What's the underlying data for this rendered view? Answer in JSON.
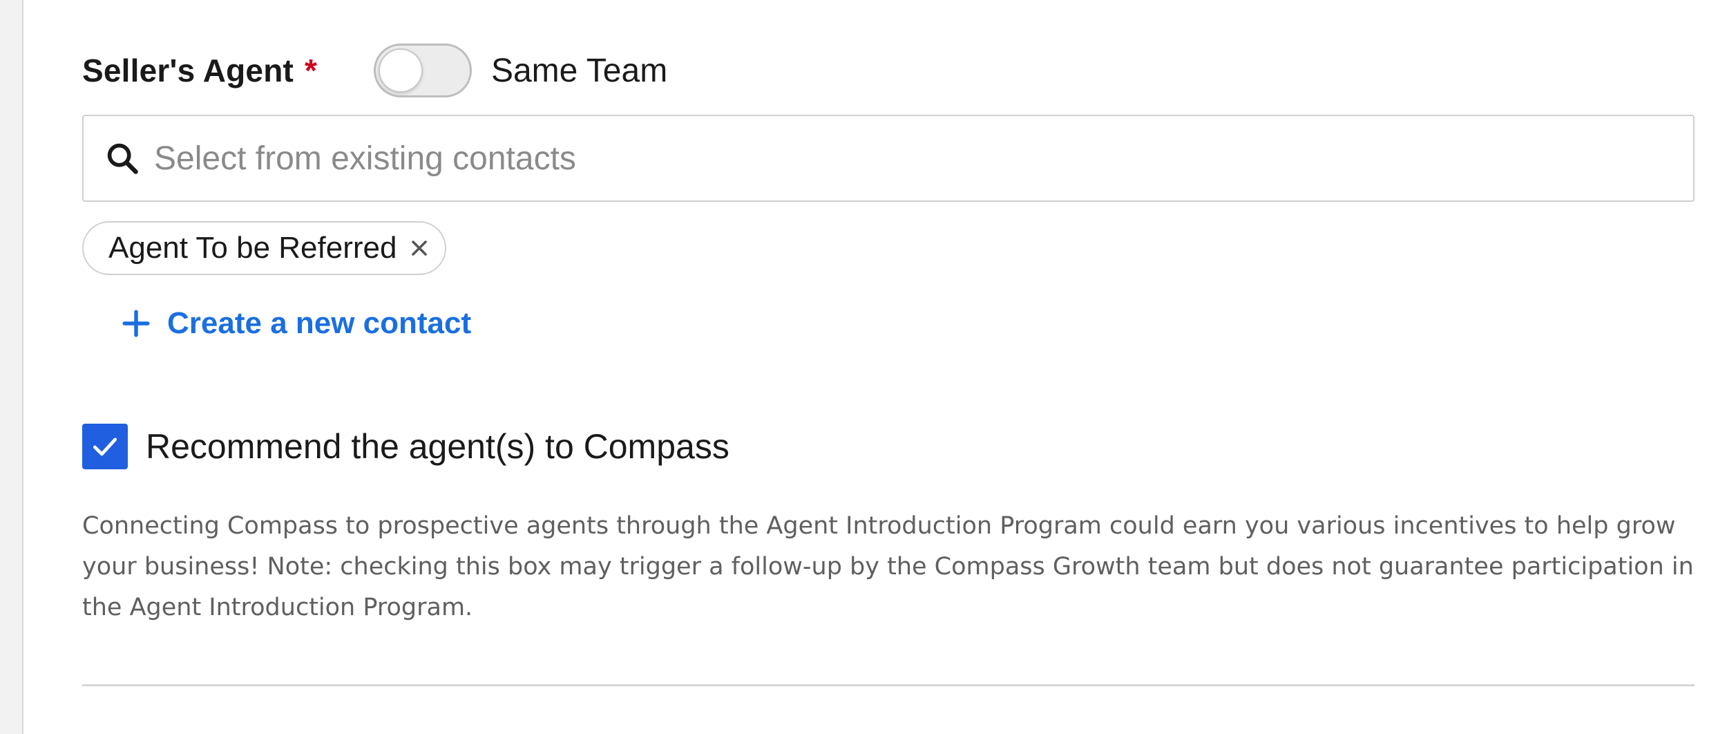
{
  "sellers_agent": {
    "label": "Seller's Agent",
    "required_marker": "*",
    "toggle_label": "Same Team",
    "toggle_on": false
  },
  "search": {
    "placeholder": "Select from existing contacts",
    "icon": "search-icon"
  },
  "selected_contacts": [
    {
      "label": "Agent To be Referred",
      "remove_icon": "close-icon"
    }
  ],
  "create_contact": {
    "label": "Create a new contact",
    "icon": "plus-icon"
  },
  "recommend": {
    "label": "Recommend the agent(s) to Compass",
    "checked": true
  },
  "help": {
    "text": "Connecting Compass to prospective agents through the Agent Introduction Program could earn you various incentives to help grow your business! Note: checking this box may trigger a follow-up by the Compass Growth team but does not guarantee participation in the Agent Introduction Program."
  },
  "colors": {
    "link": "#1a6fe0",
    "checkbox": "#1f5fe0",
    "required": "#d0021b"
  }
}
